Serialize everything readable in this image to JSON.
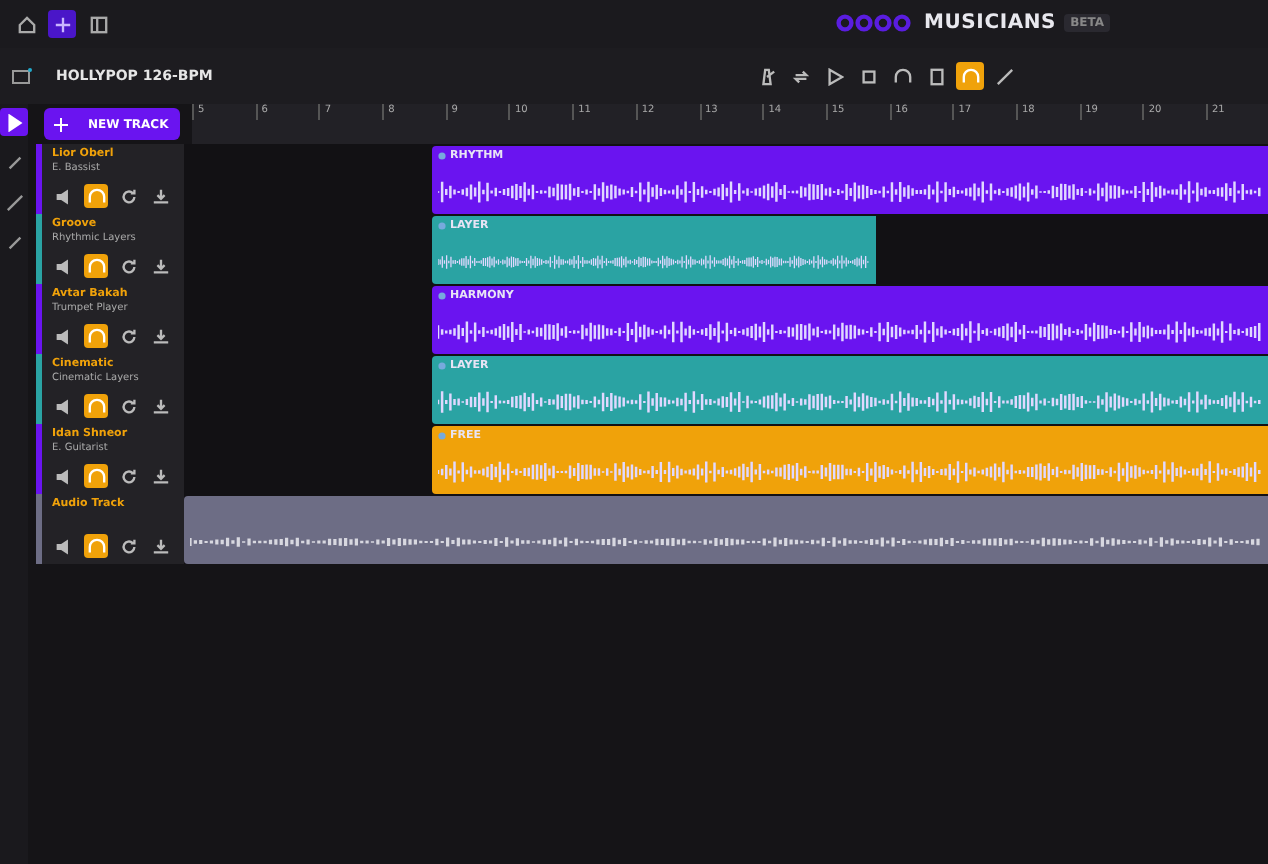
{
  "app": {
    "brand": "MUSICIANS",
    "badge": "BETA"
  },
  "nav": [
    {
      "kind": "home",
      "selected": false
    },
    {
      "kind": "compose",
      "selected": true
    },
    {
      "kind": "panel",
      "selected": false
    }
  ],
  "project": {
    "title": "HOLLYPOP 126-BPM"
  },
  "transport": [
    {
      "kind": "metronome",
      "on": false
    },
    {
      "kind": "loop",
      "on": false
    },
    {
      "kind": "play",
      "on": false
    },
    {
      "kind": "stop",
      "on": false
    },
    {
      "kind": "headphones",
      "on": false
    },
    {
      "kind": "printer",
      "on": false
    },
    {
      "kind": "monitor",
      "on": true
    },
    {
      "kind": "pen",
      "on": false
    }
  ],
  "tools": [
    {
      "kind": "pointer",
      "selected": true
    },
    {
      "kind": "eraser",
      "selected": false
    },
    {
      "kind": "pencil",
      "selected": false
    },
    {
      "kind": "brush",
      "selected": false
    }
  ],
  "new_track": "NEW TRACK",
  "ruler": [
    "5",
    "6",
    "7",
    "8",
    "9",
    "10",
    "11",
    "12",
    "13",
    "14",
    "15",
    "16",
    "17",
    "18",
    "19",
    "20",
    "21"
  ],
  "tracks": [
    {
      "name": "Lior Oberl",
      "role": "E. Bassist",
      "color": "#6a14f0",
      "solo": true,
      "clip": {
        "label": "RHYTHM",
        "kind": "full"
      }
    },
    {
      "name": "Groove",
      "role": "Rhythmic Layers",
      "color": "#2aa3a3",
      "solo": true,
      "clip": {
        "label": "LAYER",
        "kind": "short"
      }
    },
    {
      "name": "Avtar Bakah",
      "role": "Trumpet Player",
      "color": "#6a14f0",
      "solo": true,
      "clip": {
        "label": "HARMONY",
        "kind": "full"
      }
    },
    {
      "name": "Cinematic",
      "role": "Cinematic Layers",
      "color": "#2aa3a3",
      "solo": true,
      "clip": {
        "label": "LAYER",
        "kind": "full"
      }
    },
    {
      "name": "Idan Shneor",
      "role": "E. Guitarist",
      "color": "#6a14f0",
      "solo": true,
      "clip": {
        "label": "FREE",
        "kind": "full",
        "color": "#f0a20a"
      }
    },
    {
      "name": "Audio Track",
      "color": "#6d6d85",
      "solo": true,
      "clip": {
        "kind": "audio"
      }
    }
  ]
}
